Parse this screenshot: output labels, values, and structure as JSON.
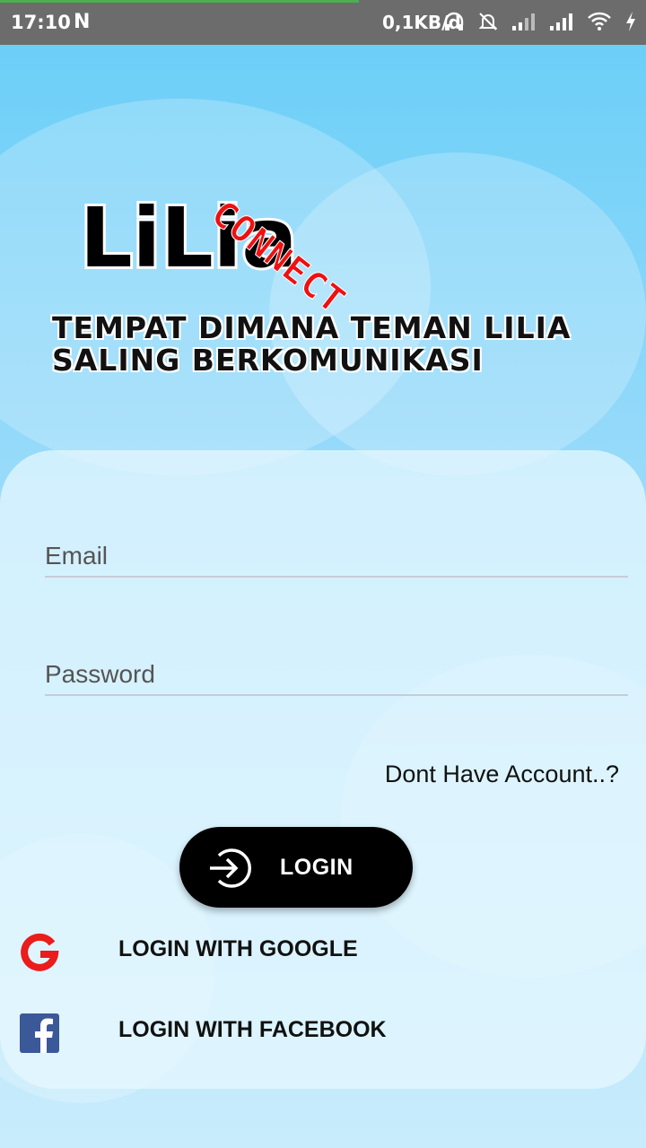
{
  "status_bar": {
    "time": "17:10",
    "network_speed": "0,1KB/d",
    "icons": [
      "notification-n-icon",
      "headphones-icon",
      "mute-bell-icon",
      "signal-1-icon",
      "signal-2-icon",
      "wifi-icon",
      "charging-icon"
    ]
  },
  "branding": {
    "logo_text": "LiLia",
    "stamp_text": "CONNECT",
    "tagline_line1": "TEMPAT DIMANA TEMAN LILIA",
    "tagline_line2": "SALING BERKOMUNIKASI"
  },
  "form": {
    "email_placeholder": "Email",
    "email_value": "",
    "password_placeholder": "Password",
    "password_value": "",
    "signup_link": "Dont Have Account..?",
    "login_label": "LOGIN",
    "google_label": "LOGIN WITH GOOGLE",
    "facebook_label": "LOGIN WITH FACEBOOK"
  },
  "colors": {
    "sky": "#6ccff8",
    "login_button": "#000000",
    "stamp": "#e11111",
    "google": "#ea1c1c",
    "facebook": "#3b5998"
  }
}
